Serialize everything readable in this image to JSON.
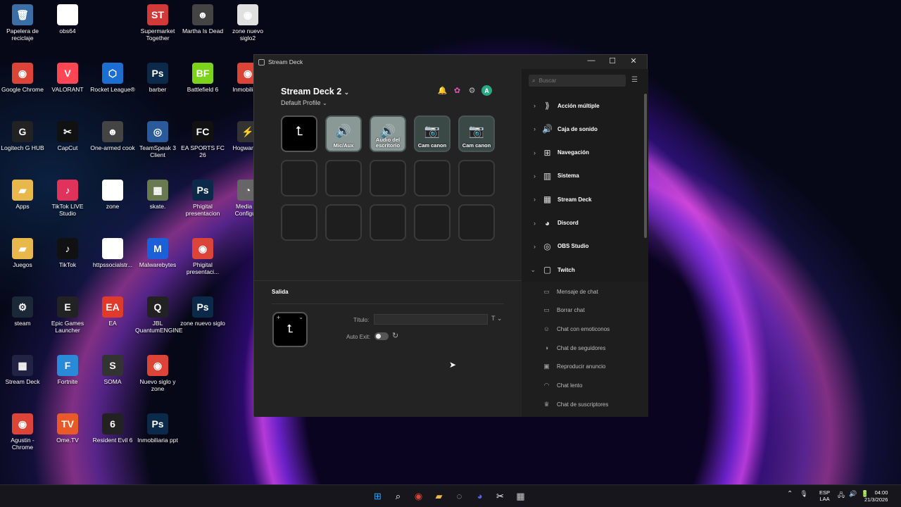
{
  "desktop": {
    "icons": [
      {
        "label": "Papelera de reciclaje",
        "glyph": "🗑",
        "color": "#3a6ea5"
      },
      {
        "label": "obs64",
        "glyph": "▯",
        "color": "#ffffff"
      },
      {
        "label": "Supermarket Together",
        "glyph": "ST",
        "color": "#d23a3a"
      },
      {
        "label": "Martha Is Dead",
        "glyph": "☻",
        "color": "#444444"
      },
      {
        "label": "zone nuevo siglo2",
        "glyph": "◉",
        "color": "#e0e0e0"
      },
      {
        "label": "Google Chrome",
        "glyph": "◉",
        "color": "#db4437"
      },
      {
        "label": "VALORANT",
        "glyph": "V",
        "color": "#ff4655"
      },
      {
        "label": "Rocket League®",
        "glyph": "⬡",
        "color": "#1c6fd1"
      },
      {
        "label": "barber",
        "glyph": "Ps",
        "color": "#0b2a4a"
      },
      {
        "label": "Battlefield 6",
        "glyph": "BF",
        "color": "#7cd31c"
      },
      {
        "label": "Inmobiliaria",
        "glyph": "◉",
        "color": "#db4437"
      },
      {
        "label": "Logitech G HUB",
        "glyph": "G",
        "color": "#222222"
      },
      {
        "label": "CapCut",
        "glyph": "✂",
        "color": "#111111"
      },
      {
        "label": "One-armed cook",
        "glyph": "☻",
        "color": "#444444"
      },
      {
        "label": "TeamSpeak 3 Client",
        "glyph": "◎",
        "color": "#2a5a9a"
      },
      {
        "label": "EA SPORTS FC 26",
        "glyph": "FC",
        "color": "#111111"
      },
      {
        "label": "Hogwarts L",
        "glyph": "⚡",
        "color": "#333333"
      },
      {
        "label": "Apps",
        "glyph": "▰",
        "color": "#e8b84a"
      },
      {
        "label": "TikTok LIVE Studio",
        "glyph": "♪",
        "color": "#e0325a"
      },
      {
        "label": "zone",
        "glyph": "▯",
        "color": "#ffffff"
      },
      {
        "label": "skate.",
        "glyph": "▦",
        "color": "#6a7a50"
      },
      {
        "label": "Phigital presentacion",
        "glyph": "Ps",
        "color": "#0b2a4a"
      },
      {
        "label": "Media Pr Configura",
        "glyph": "◔",
        "color": "#666666"
      },
      {
        "label": "Juegos",
        "glyph": "▰",
        "color": "#e8b84a"
      },
      {
        "label": "TikTok",
        "glyph": "♪",
        "color": "#111111"
      },
      {
        "label": "httpssocialstr...",
        "glyph": "▯",
        "color": "#ffffff"
      },
      {
        "label": "Malwarebytes",
        "glyph": "M",
        "color": "#1d5fd8"
      },
      {
        "label": "Phigital presentaci...",
        "glyph": "◉",
        "color": "#db4437"
      },
      {
        "label": "steam",
        "glyph": "⚙",
        "color": "#1b2838"
      },
      {
        "label": "Epic Games Launcher",
        "glyph": "E",
        "color": "#222222"
      },
      {
        "label": "EA",
        "glyph": "EA",
        "color": "#e03a2a"
      },
      {
        "label": "JBL QuantumENGINE",
        "glyph": "Q",
        "color": "#222222"
      },
      {
        "label": "zone nuevo siglo",
        "glyph": "Ps",
        "color": "#0b2a4a"
      },
      {
        "label": "Stream Deck",
        "glyph": "▦",
        "color": "#222244"
      },
      {
        "label": "Fortnite",
        "glyph": "F",
        "color": "#2a8ad8"
      },
      {
        "label": "SOMA",
        "glyph": "S",
        "color": "#333333"
      },
      {
        "label": "Nuevo siglo y zone",
        "glyph": "◉",
        "color": "#db4437"
      },
      {
        "label": "Agustin - Chrome",
        "glyph": "◉",
        "color": "#db4437"
      },
      {
        "label": "Ome.TV",
        "glyph": "TV",
        "color": "#e85a2a"
      },
      {
        "label": "Resident Evil 6",
        "glyph": "6",
        "color": "#222222"
      },
      {
        "label": "Inmobiliaria ppt",
        "glyph": "Ps",
        "color": "#0b2a4a"
      }
    ]
  },
  "window": {
    "title": "Stream Deck",
    "controls": {
      "minimize": "—",
      "maximize": "☐",
      "close": "✕"
    }
  },
  "deck": {
    "name": "Stream Deck 2",
    "name_chevron": "⌄",
    "profile": "Default Profile",
    "profile_chevron": "⌄",
    "toolbar": {
      "bell": "🔔",
      "store": "✿",
      "settings": "⚙",
      "avatar": "A"
    },
    "keys": [
      {
        "style": "black",
        "glyph": "⮤",
        "label": ""
      },
      {
        "style": "mic",
        "glyph": "🔊",
        "label": "Mic/Aux"
      },
      {
        "style": "mic",
        "glyph": "🔊",
        "label": "Audio del escritorio"
      },
      {
        "style": "cam",
        "glyph": "📷",
        "label": "Cam canon"
      },
      {
        "style": "cam",
        "glyph": "📷",
        "label": "Cam canon"
      },
      {
        "style": "empty",
        "glyph": "",
        "label": ""
      },
      {
        "style": "empty",
        "glyph": "",
        "label": ""
      },
      {
        "style": "empty",
        "glyph": "",
        "label": ""
      },
      {
        "style": "empty",
        "glyph": "",
        "label": ""
      },
      {
        "style": "empty",
        "glyph": "",
        "label": ""
      },
      {
        "style": "empty",
        "glyph": "",
        "label": ""
      },
      {
        "style": "empty",
        "glyph": "",
        "label": ""
      },
      {
        "style": "empty",
        "glyph": "",
        "label": ""
      },
      {
        "style": "empty",
        "glyph": "",
        "label": ""
      },
      {
        "style": "empty",
        "glyph": "",
        "label": ""
      }
    ]
  },
  "inspector": {
    "section_title": "Salida",
    "preview_glyph": "⮤",
    "preview_plus": "+",
    "preview_chevron": "⌄",
    "title_label": "Título:",
    "title_value": "",
    "title_type_icon": "T ⌄",
    "auto_exit_label": "Auto Exit:",
    "auto_exit_on": false,
    "reset_icon": "↻"
  },
  "actions": {
    "search_placeholder": "Buscar",
    "search_icon": "⌕",
    "list_icon": "☰",
    "categories": [
      {
        "label": "Acción múltiple",
        "icon": "⟫",
        "expanded": false
      },
      {
        "label": "Caja de sonido",
        "icon": "🔊",
        "expanded": false
      },
      {
        "label": "Navegación",
        "icon": "⊞",
        "expanded": false
      },
      {
        "label": "Sistema",
        "icon": "▥",
        "expanded": false
      },
      {
        "label": "Stream Deck",
        "icon": "▦",
        "expanded": false
      },
      {
        "label": "Discord",
        "icon": "◕",
        "expanded": false
      },
      {
        "label": "OBS Studio",
        "icon": "◎",
        "expanded": false
      },
      {
        "label": "Twitch",
        "icon": "▢",
        "expanded": true
      }
    ],
    "twitch_items": [
      {
        "label": "Mensaje de chat",
        "icon": "▭"
      },
      {
        "label": "Borrar chat",
        "icon": "▭"
      },
      {
        "label": "Chat con emoticonos",
        "icon": "☺"
      },
      {
        "label": "Chat de seguidores",
        "icon": "◑"
      },
      {
        "label": "Reproducir anuncio",
        "icon": "▣"
      },
      {
        "label": "Chat lento",
        "icon": "◠"
      },
      {
        "label": "Chat de suscriptores",
        "icon": "♛"
      }
    ]
  },
  "taskbar": {
    "apps": [
      {
        "name": "windows-start",
        "glyph": "⊞",
        "color": "#3aa0f0"
      },
      {
        "name": "search",
        "glyph": "⌕",
        "color": "#ffffff"
      },
      {
        "name": "chrome",
        "glyph": "◉",
        "color": "#db4437"
      },
      {
        "name": "file-explorer",
        "glyph": "▰",
        "color": "#e8b84a"
      },
      {
        "name": "app-circle",
        "glyph": "◌",
        "color": "#cccccc"
      },
      {
        "name": "discord",
        "glyph": "◕",
        "color": "#5865f2"
      },
      {
        "name": "capcut",
        "glyph": "✂",
        "color": "#ffffff"
      },
      {
        "name": "stream-deck",
        "glyph": "▦",
        "color": "#cccccc"
      }
    ],
    "tray_icons": [
      "⌃",
      "🎙"
    ],
    "lang_1": "ESP",
    "lang_2": "LAA",
    "tray_icons2": [
      "🖧",
      "🔊",
      "🔋"
    ],
    "time": "04:00",
    "date": "21/3/2026"
  }
}
